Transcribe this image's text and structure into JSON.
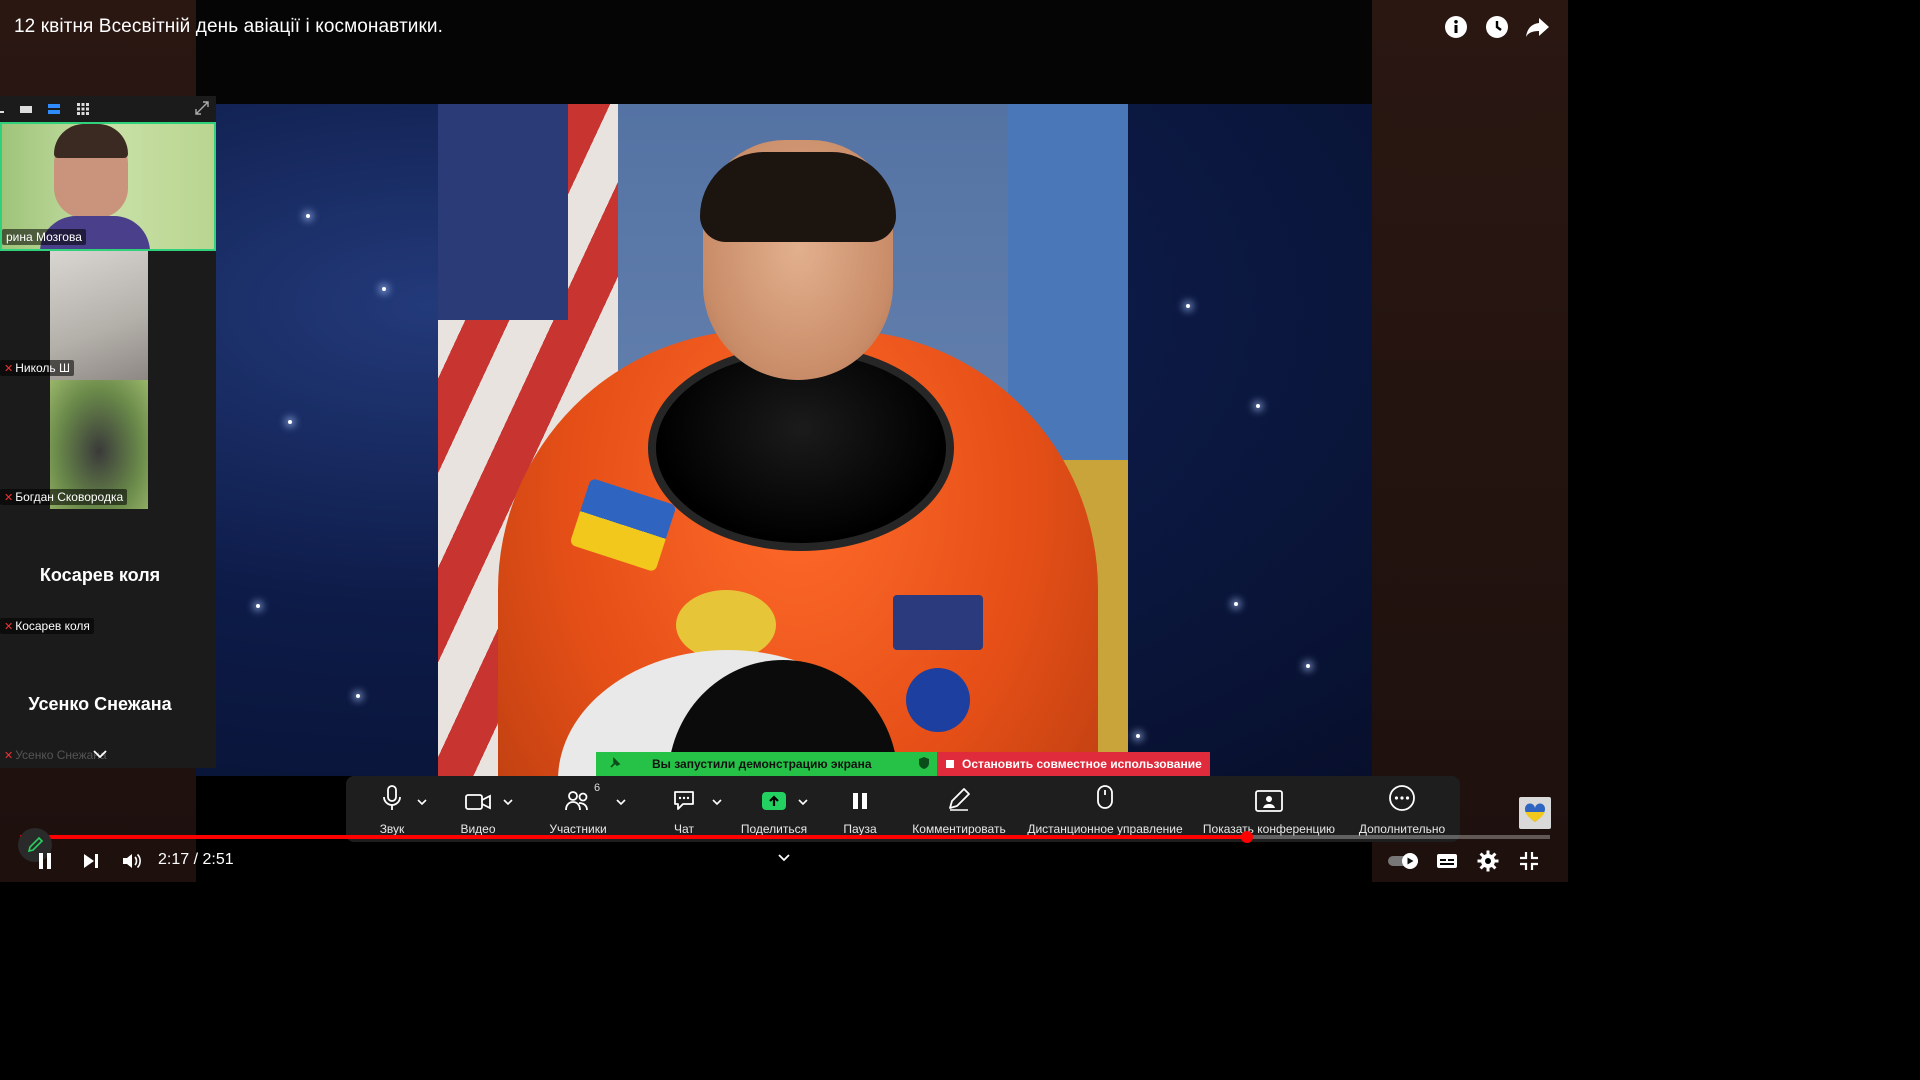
{
  "video": {
    "title": "12 квітня Всесвітній день авіації і космонавтики.",
    "current_time": "2:17",
    "duration": "2:51",
    "time_display": "2:17 / 2:51",
    "progress_fraction": 0.802
  },
  "top_icons": [
    "info-icon",
    "clock-icon",
    "share-icon"
  ],
  "participants_panel": {
    "view_buttons": [
      "minimize-icon",
      "speaker-view-icon",
      "strip-view-icon",
      "gallery-view-icon",
      "expand-icon"
    ],
    "tiles": [
      {
        "name": "рина Мозгова",
        "active": true,
        "muted": false,
        "video": true
      },
      {
        "name": "Николь Ш",
        "active": false,
        "muted": true,
        "video": true
      },
      {
        "name": "Богдан Сковородка",
        "active": false,
        "muted": true,
        "video": true
      },
      {
        "name": "Косарев коля",
        "display_name": "Косарев коля",
        "active": false,
        "muted": true,
        "video": false
      },
      {
        "name": "Усенко Снежана",
        "display_name": "Усенко Снежана",
        "active": false,
        "muted": true,
        "video": false
      }
    ]
  },
  "share_banner": {
    "status": "Вы запустили демонстрацию экрана",
    "stop": "Остановить совместное использование"
  },
  "toolbar": {
    "audio": "Звук",
    "video": "Видео",
    "participants": "Участники",
    "participants_count": "6",
    "chat": "Чат",
    "share": "Поделиться",
    "pause": "Пауза",
    "annotate": "Комментировать",
    "remote_control": "Дистанционное управление",
    "show_conference": "Показать конференцию",
    "more": "Дополнительно"
  },
  "colors": {
    "progress_red": "#ff0000",
    "share_green": "#26c247",
    "share_red": "#e02b3c",
    "active_tile_border": "#2fd27a",
    "toolbar_bg": "#1e1e1e"
  }
}
